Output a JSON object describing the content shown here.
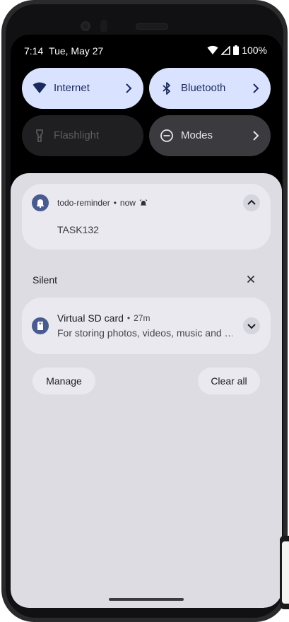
{
  "status_bar": {
    "time": "7:14",
    "date": "Tue, May 27",
    "battery": "100%",
    "icons": [
      "wifi-icon",
      "cell-signal-icon",
      "battery-icon"
    ]
  },
  "quick_settings": {
    "tiles": [
      {
        "label": "Internet",
        "icon": "wifi-icon",
        "state": "on"
      },
      {
        "label": "Bluetooth",
        "icon": "bluetooth-icon",
        "state": "on"
      },
      {
        "label": "Flashlight",
        "icon": "flashlight-icon",
        "state": "off"
      },
      {
        "label": "Modes",
        "icon": "do-not-disturb-icon",
        "state": "off"
      }
    ]
  },
  "notifications": {
    "todo": {
      "app": "todo-reminder",
      "separator": "•",
      "time": "now",
      "title": "TASK132",
      "icon": "bell-icon",
      "alarm_icon": "alarm-icon"
    },
    "silent_header": {
      "label": "Silent"
    },
    "sdcard": {
      "title": "Virtual SD card",
      "separator": "•",
      "time": "27m",
      "body": "For storing photos, videos, music and …",
      "icon": "sd-card-icon"
    }
  },
  "actions": {
    "manage": "Manage",
    "clear_all": "Clear all"
  },
  "colors": {
    "accent_tile": "#d9e2ff",
    "shade_bg": "#dddce3",
    "card_bg": "#eae9f0",
    "app_icon_bg": "#4a5c8f"
  }
}
